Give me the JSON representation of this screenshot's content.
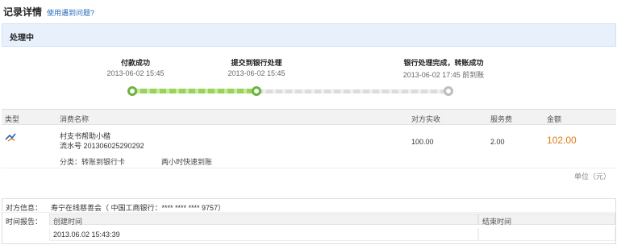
{
  "header": {
    "title": "记录详情",
    "help_link": "使用遇到问题?"
  },
  "status": {
    "text": "处理中"
  },
  "steps": [
    {
      "label": "付款成功",
      "time": "2013-06-02 15:45"
    },
    {
      "label": "提交到银行处理",
      "time": "2013-06-02 15:45"
    },
    {
      "label": "银行处理完成，转账成功",
      "time": "2013-06-02 17:45 前到账"
    }
  ],
  "progress": {
    "completed_steps": 2,
    "total_steps": 3
  },
  "table": {
    "headers": {
      "type": "类型",
      "name": "消费名称",
      "counterpart": "对方实收",
      "fee": "服务费",
      "amount": "金额"
    },
    "row": {
      "icon": "transfer-bird-icon",
      "name": "村支书帮助小楷",
      "serial": "流水号 201306025290292",
      "counterpart": "100.00",
      "fee": "2.00",
      "amount": "102.00",
      "category": "分类：转账到银行卡",
      "speed": "两小时快速到账"
    },
    "unit": "单位（元）"
  },
  "info": {
    "counterparty_label": "对方信息：",
    "counterparty_value": "寿宁在线慈善会（ 中国工商银行：**** **** **** 9757）",
    "time_label": "时间报告：",
    "created_header": "创建时间",
    "created_value": "2013.06.02 15:43:39",
    "end_header": "结束时间",
    "end_value": ""
  },
  "colors": {
    "accent_green": "#6db33f",
    "amount_orange": "#e07b12",
    "link_blue": "#1f68b8"
  }
}
